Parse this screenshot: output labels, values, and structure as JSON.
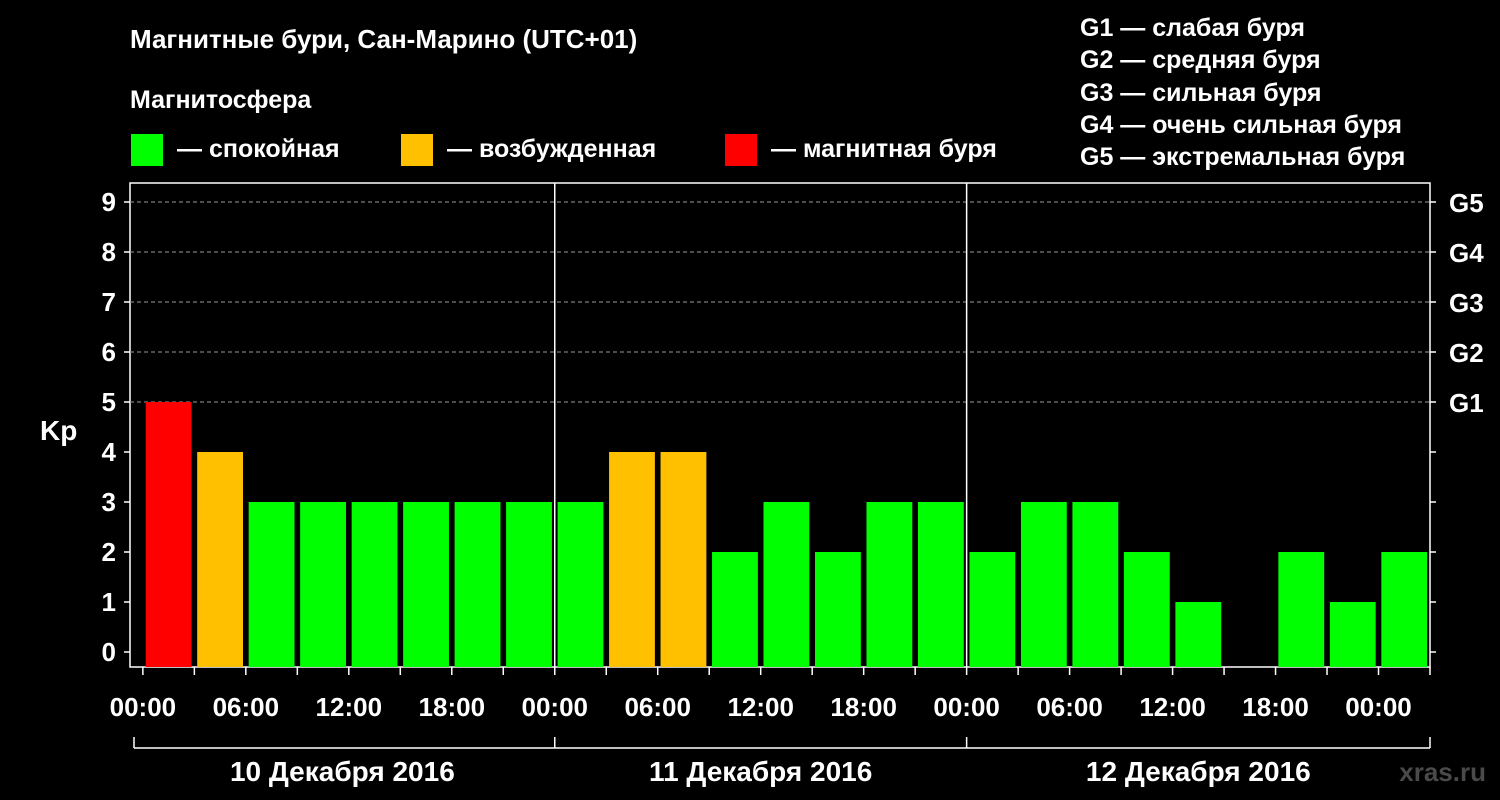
{
  "chart_data": {
    "type": "bar",
    "title": "Магнитные бури, Сан-Марино (UTC+01)",
    "subtitle": "Магнитосфера",
    "ylabel": "Kp",
    "ylim": [
      0,
      9
    ],
    "yticks": [
      "0",
      "1",
      "2",
      "3",
      "4",
      "5",
      "6",
      "7",
      "8",
      "9"
    ],
    "y2ticks": [
      {
        "value": 5,
        "label": "G1"
      },
      {
        "value": 6,
        "label": "G2"
      },
      {
        "value": 7,
        "label": "G3"
      },
      {
        "value": 8,
        "label": "G4"
      },
      {
        "value": 9,
        "label": "G5"
      }
    ],
    "x_tick_labels": [
      "00:00",
      "06:00",
      "12:00",
      "18:00",
      "00:00",
      "06:00",
      "12:00",
      "18:00",
      "00:00",
      "06:00",
      "12:00",
      "18:00",
      "00:00"
    ],
    "days": [
      "10 Декабря 2016",
      "11 Декабря 2016",
      "12 Декабря 2016"
    ],
    "interval_hours": 3,
    "values": [
      5,
      4,
      3,
      3,
      3,
      3,
      3,
      3,
      3,
      4,
      4,
      2,
      3,
      2,
      3,
      3,
      2,
      3,
      3,
      2,
      1,
      0,
      2,
      1,
      2
    ],
    "colors": {
      "quiet": "#00ff00",
      "active": "#ffc000",
      "storm": "#ff0000"
    },
    "legend": [
      {
        "color": "#00ff00",
        "label": "— спокойная"
      },
      {
        "color": "#ffc000",
        "label": "— возбужденная"
      },
      {
        "color": "#ff0000",
        "label": "— магнитная буря"
      }
    ],
    "storm_levels": [
      "G1 — слабая буря",
      "G2 — средняя буря",
      "G3 — сильная буря",
      "G4 — очень сильная буря",
      "G5 — экстремальная буря"
    ],
    "grid": "dashed horizontal",
    "legend_position": "top"
  },
  "watermark": "xras.ru"
}
